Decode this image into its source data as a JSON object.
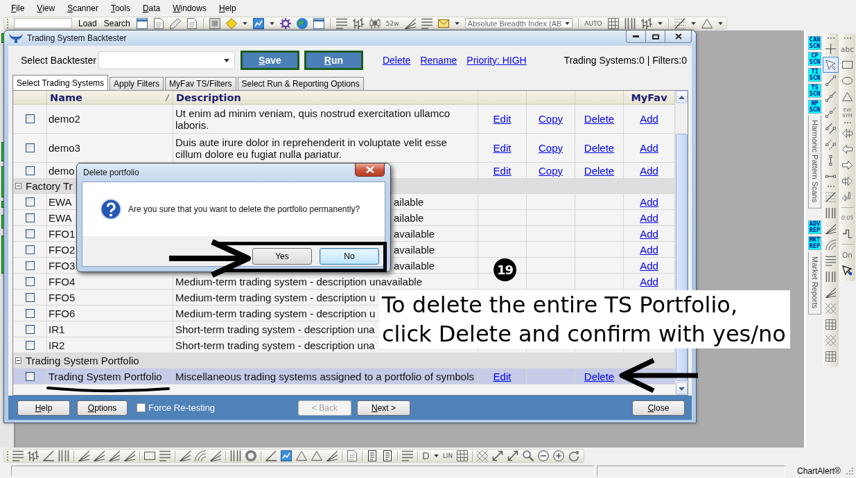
{
  "menu_bar": [
    "File",
    "View",
    "Scanner",
    "Tools",
    "Data",
    "Windows",
    "Help"
  ],
  "toolbar": {
    "buttons": [
      "Load",
      "Search"
    ],
    "labels": [
      "52w",
      "AUTO"
    ],
    "indicator": "Absolute Breadth Index (AB"
  },
  "backtester": {
    "title": "Trading System Backtester",
    "select_label": "Select Backtester",
    "buttons": [
      "Save",
      "Run"
    ],
    "links": [
      "Delete",
      "Rename",
      "Priority: HIGH"
    ],
    "summary": "Trading Systems:0 | Filters:0",
    "tabs": [
      {
        "label": "Select Trading Systems",
        "selected": true
      },
      {
        "label": "Apply Filters",
        "selected": false
      },
      {
        "label": "MyFav TS/Filters",
        "selected": false
      },
      {
        "label": "Select Run & Reporting Options",
        "selected": false
      }
    ],
    "table": {
      "columns": [
        "Name",
        "Description",
        "MyFav"
      ],
      "rows": [
        {
          "kind": "item",
          "name": "demo2",
          "description": "Ut enim ad minim veniam, quis nostrud exercitation ullamco laboris.",
          "edit": "Edit",
          "copy": "Copy",
          "delete": "Delete",
          "myfav": "Add",
          "checked": false,
          "selected": false
        },
        {
          "kind": "item",
          "name": "demo3",
          "description": "Duis aute irure dolor in reprehenderit in voluptate velit esse cillum dolore eu fugiat nulla pariatur.",
          "edit": "Edit",
          "copy": "Copy",
          "delete": "Delete",
          "myfav": "Add",
          "checked": false,
          "selected": false
        },
        {
          "kind": "item",
          "name": "demo",
          "edit": "Edit",
          "copy": "Copy",
          "delete": "Delete",
          "myfav": "Add",
          "checked": false,
          "selected": false
        },
        {
          "kind": "group",
          "label": "Factory Tr",
          "expanded": true
        },
        {
          "kind": "item",
          "name": "EWA",
          "description": "ailable",
          "myfav": "Add",
          "checked": false,
          "selected": false
        },
        {
          "kind": "item",
          "name": "EWA",
          "description": "ailable",
          "myfav": "Add",
          "checked": false,
          "selected": false
        },
        {
          "kind": "item",
          "name": "FFO1",
          "description": "available",
          "myfav": "Add",
          "checked": false,
          "selected": false
        },
        {
          "kind": "item",
          "name": "FFO2",
          "description": "available",
          "myfav": "Add",
          "checked": false,
          "selected": false
        },
        {
          "kind": "item",
          "name": "FFO3",
          "description": "available",
          "myfav": "Add",
          "checked": false,
          "selected": false
        },
        {
          "kind": "item",
          "name": "FFO4",
          "description": "Medium-term trading system - description unavailable",
          "myfav": "Add",
          "checked": false,
          "selected": false
        },
        {
          "kind": "item",
          "name": "FFO5",
          "description": "Medium-term trading system - description u",
          "checked": false,
          "selected": false
        },
        {
          "kind": "item",
          "name": "FFO6",
          "description": "Medium-term trading system - description u",
          "checked": false,
          "selected": false
        },
        {
          "kind": "item",
          "name": "IR1",
          "description": "Short-term trading system - description una",
          "checked": false,
          "selected": false
        },
        {
          "kind": "item",
          "name": "IR2",
          "description": "Short-term trading system - description una",
          "checked": false,
          "selected": false
        },
        {
          "kind": "group",
          "label": "Trading System Portfolio",
          "expanded": true
        },
        {
          "kind": "item",
          "name": "Trading System Portfolio",
          "description": "Miscellaneous trading systems assigned to a portfolio of symbols",
          "edit": "Edit",
          "delete": "Delete",
          "checked": false,
          "selected": true
        }
      ]
    },
    "footer": {
      "help": "Help",
      "options": "Options",
      "force_retesting": {
        "label": "Force Re-testing",
        "checked": false
      },
      "back": {
        "label": "< Back",
        "disabled": true
      },
      "next": {
        "label": "Next >",
        "disabled": false
      },
      "close": "Close"
    }
  },
  "confirm_dialog": {
    "title": "Delete portfolio",
    "message": "Are you sure that you want to delete the portfolio permanently?",
    "buttons": [
      {
        "label": "Yes",
        "focused": false
      },
      {
        "label": "No",
        "focused": true
      }
    ]
  },
  "annotations": {
    "step": "19",
    "callout": "To delete the entire TS Portfolio,\nclick Delete and confirm with yes/no"
  },
  "scan_panel": {
    "buttons": [
      "CAN SCN",
      "CP SCN",
      "TI SCN",
      "TS SCN",
      "HP SCN"
    ],
    "title": "Harmonic Pattern Scans"
  },
  "report_panel": {
    "buttons": [
      "ADV REP",
      "MKT REP"
    ],
    "title": "Market Reports"
  },
  "drawing_tools": [
    {
      "selected": false
    },
    {
      "selected": true
    },
    {
      "selected": false
    },
    {
      "selected": false
    },
    {
      "selected": false
    },
    {
      "selected": false
    },
    {
      "selected": false
    },
    {
      "selected": false
    },
    {
      "selected": false
    }
  ],
  "shape_tools": {
    "labels": [
      "abc",
      "EW SYM",
      "0:05",
      "On"
    ]
  },
  "bottom_toolbar": {
    "labels": [
      "D",
      "LIN"
    ]
  },
  "status_bar": {
    "app_name": "ChartAlert®"
  }
}
